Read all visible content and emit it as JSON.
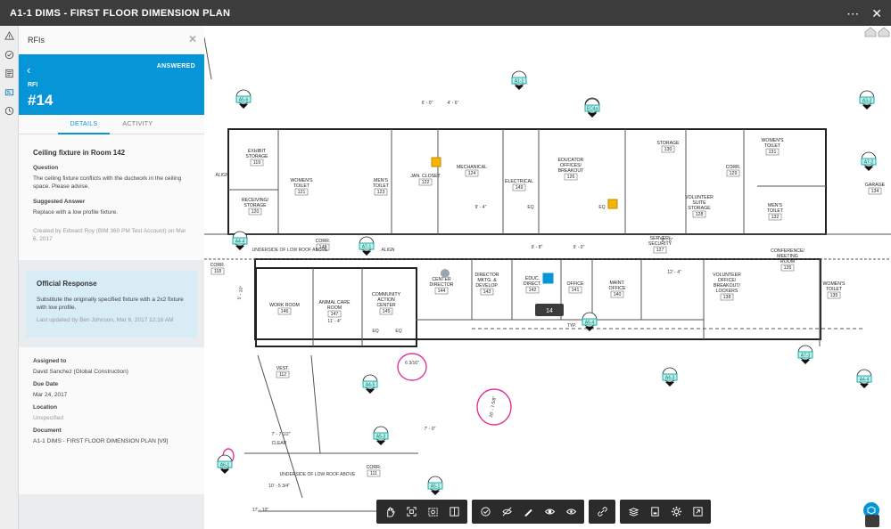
{
  "window": {
    "title": "A1-1 DIMS - FIRST FLOOR DIMENSION PLAN"
  },
  "topbar": {
    "more_icon": "ellipsis-icon",
    "close_icon": "close-icon"
  },
  "rail": {
    "icons": [
      "warning-icon",
      "check-circle-icon",
      "sheet-icon",
      "id-card-icon",
      "clock-icon"
    ]
  },
  "panel": {
    "header": "RFIs",
    "status": "ANSWERED",
    "rfi_label": "RFI",
    "rfi_number": "#14",
    "tabs": [
      "DETAILS",
      "ACTIVITY"
    ],
    "title": "Ceiling fixture in Room 142",
    "question_label": "Question",
    "question_text": "The ceiling fixture conflicts with the ductwork in the ceiling space.  Please advise.",
    "suggested_label": "Suggested Answer",
    "suggested_text": "Replace with a low profile fixture.",
    "created_by": "Created by Edward Roy (BIM 360 PM Test Account) on Mar 6, 2017",
    "official": {
      "heading": "Official Response",
      "text": "Substitute the originally specified fixture with a 2x2 fixture with low profile.",
      "updated": "Last updated by Ben Johnson, Mar 6, 2017 12:16 AM"
    },
    "assigned_label": "Assigned to",
    "assigned_value": "David Sanchez (Global Construction)",
    "due_label": "Due Date",
    "due_value": "Mar 24, 2017",
    "location_label": "Location",
    "location_value": "Unspecified",
    "document_label": "Document",
    "document_value": "A1-1 DIMS - FIRST FLOOR DIMENSION PLAN [V9]"
  },
  "drawing": {
    "rooms": [
      {
        "name": "EXHIBIT STORAGE",
        "num": "119"
      },
      {
        "name": "WOMEN'S TOILET",
        "num": "121"
      },
      {
        "name": "MEN'S TOILET",
        "num": "123"
      },
      {
        "name": "JAN. CLOSET",
        "num": "122"
      },
      {
        "name": "MECHANICAL",
        "num": "124"
      },
      {
        "name": "ELECTRICAL",
        "num": "149"
      },
      {
        "name": "EDUCATOR OFFICES/ BREAKOUT",
        "num": "126"
      },
      {
        "name": "STORAGE",
        "num": "130"
      },
      {
        "name": "WOMEN'S TOILET",
        "num": "131"
      },
      {
        "name": "GARAGE",
        "num": "134"
      },
      {
        "name": "RECEIVING/ STORAGE",
        "num": "120"
      },
      {
        "name": "VOLUNTEER SUITE STORAGE",
        "num": "128"
      },
      {
        "name": "MEN'S TOILET",
        "num": "132"
      },
      {
        "name": "CORR.",
        "num": "129"
      },
      {
        "name": "CORR.",
        "num": "148"
      },
      {
        "name": "SERVER/ SECURITY",
        "num": "127"
      },
      {
        "name": "CORR.",
        "num": "118"
      },
      {
        "name": "CONFERENCE/ MEETING ROOM",
        "num": "135"
      },
      {
        "name": "WORK ROOM",
        "num": "146"
      },
      {
        "name": "ANIMAL CARE ROOM",
        "num": "147"
      },
      {
        "name": "COMMUNITY ACTION CENTER",
        "num": "145"
      },
      {
        "name": "CENTER DIRECTOR",
        "num": "144"
      },
      {
        "name": "DIRECTOR MKTG. & DEVELOP.",
        "num": "143"
      },
      {
        "name": "EDUC. DIRECT.",
        "num": "142"
      },
      {
        "name": "OFFICE",
        "num": "141"
      },
      {
        "name": "MAINT. OFFICE",
        "num": "140"
      },
      {
        "name": "VOLUNTEER OFFICE/ BREAKOUT/ LOCKERS",
        "num": "138"
      },
      {
        "name": "WOMEN'S TOILET",
        "num": "135"
      },
      {
        "name": "VEST.",
        "num": "112"
      },
      {
        "name": "CORR.",
        "num": "111"
      }
    ],
    "pin_label": "14",
    "dims": [
      "6' - 0\"",
      "4' - 6\"",
      "9' - 4\"",
      "9' - 8\"",
      "9' - 0\"",
      "6' - 0\"",
      "12' - 4\"",
      "11' - 4\"",
      "5' - 10\"",
      "7' - 0\"",
      "10' - 5 3/4\"",
      "17' - 10\"",
      "7' - 7 1/2\"",
      "CLEAR",
      "6 3/16\"",
      "26' - 7 5/8\""
    ],
    "notes": [
      "UNDERSIDE OF LOW ROOF ABOVE",
      "UNDERSIDE OF LOW ROOF ABOVE",
      "ALIGN",
      "ALIGN",
      "TYP.",
      "EQ",
      "EQ",
      "EQ",
      "EQ"
    ],
    "tags": [
      "A1-1",
      "A5-1",
      "A5-6",
      "A7-1",
      "A4-4",
      "A4-5",
      "A4-3",
      "A7-3",
      "A5-1",
      "A5-4",
      "A6-1",
      "A7-2",
      "EC4a",
      "A5-3",
      "A3-3",
      "A4-4"
    ]
  },
  "toolbar": {
    "groups": [
      [
        "pan-icon",
        "fit-icon",
        "zoom-region-icon",
        "split-view-icon"
      ],
      [
        "markup-icon",
        "hide-markup-icon",
        "pen-icon",
        "visibility-icon",
        "eye-icon"
      ],
      [
        "link-icon"
      ],
      [
        "layers-icon",
        "sheet-info-icon",
        "settings-icon",
        "fullscreen-icon"
      ]
    ]
  },
  "accent": "#0696d7"
}
